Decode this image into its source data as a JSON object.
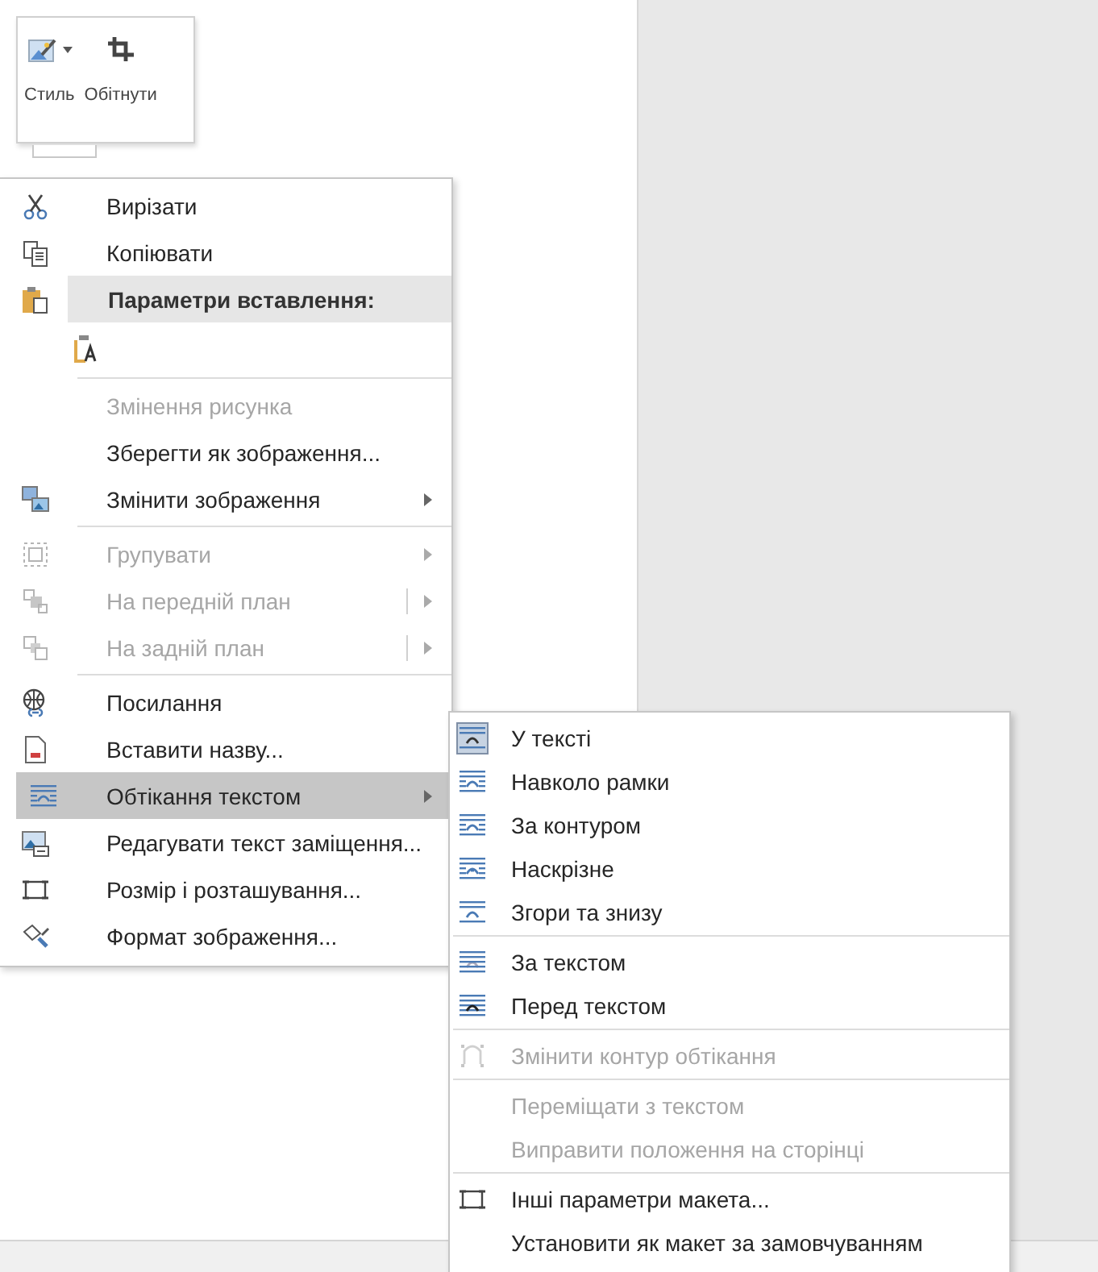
{
  "mini_toolbar": {
    "buttons": [
      {
        "label": "Стиль",
        "kind": "style",
        "dropdown": true
      },
      {
        "label": "Обітнути",
        "kind": "crop",
        "dropdown": false
      }
    ]
  },
  "context_menu": {
    "items": [
      {
        "kind": "cut",
        "label": "Вирізати",
        "disabled": false,
        "highlighted": false,
        "separator_before": false,
        "submenu": false,
        "split": false
      },
      {
        "kind": "copy",
        "label": "Копіювати",
        "disabled": false,
        "highlighted": false,
        "separator_before": false,
        "submenu": false,
        "split": false
      },
      {
        "kind": "paste_header",
        "label": "Параметри вставлення:"
      },
      {
        "kind": "paste_options"
      },
      {
        "kind": "plain",
        "label": "Змінення рисунка",
        "disabled": true,
        "highlighted": false,
        "separator_before": true,
        "submenu": false,
        "split": false
      },
      {
        "kind": "plain",
        "label": "Зберегти як зображення...",
        "disabled": false,
        "highlighted": false,
        "separator_before": false,
        "submenu": false,
        "split": false
      },
      {
        "kind": "change_picture",
        "label": "Змінити зображення",
        "disabled": false,
        "highlighted": false,
        "separator_before": false,
        "submenu": true,
        "split": false
      },
      {
        "kind": "group",
        "label": "Групувати",
        "disabled": true,
        "highlighted": false,
        "separator_before": true,
        "submenu": true,
        "split": false
      },
      {
        "kind": "front",
        "label": "На передній план",
        "disabled": true,
        "highlighted": false,
        "separator_before": false,
        "submenu": true,
        "split": true
      },
      {
        "kind": "back",
        "label": "На задній план",
        "disabled": true,
        "highlighted": false,
        "separator_before": false,
        "submenu": true,
        "split": true
      },
      {
        "kind": "link",
        "label": "Посилання",
        "disabled": false,
        "highlighted": false,
        "separator_before": true,
        "submenu": false,
        "split": false
      },
      {
        "kind": "caption",
        "label": "Вставити назву...",
        "disabled": false,
        "highlighted": false,
        "separator_before": false,
        "submenu": false,
        "split": false
      },
      {
        "kind": "wrap",
        "label": "Обтікання текстом",
        "disabled": false,
        "highlighted": true,
        "separator_before": false,
        "submenu": true,
        "split": false
      },
      {
        "kind": "alt_text",
        "label": "Редагувати текст заміщення...",
        "disabled": false,
        "highlighted": false,
        "separator_before": false,
        "submenu": false,
        "split": false
      },
      {
        "kind": "size",
        "label": "Розмір і розташування...",
        "disabled": false,
        "highlighted": false,
        "separator_before": false,
        "submenu": false,
        "split": false
      },
      {
        "kind": "format",
        "label": "Формат зображення...",
        "disabled": false,
        "highlighted": false,
        "separator_before": false,
        "submenu": false,
        "split": false
      }
    ]
  },
  "wrap_submenu": {
    "items": [
      {
        "kind": "inline",
        "label": "У тексті",
        "selected": true,
        "disabled": false,
        "separator_before": false
      },
      {
        "kind": "square",
        "label": "Навколо рамки",
        "selected": false,
        "disabled": false,
        "separator_before": false
      },
      {
        "kind": "tight",
        "label": "За контуром",
        "selected": false,
        "disabled": false,
        "separator_before": false
      },
      {
        "kind": "through",
        "label": "Наскрізне",
        "selected": false,
        "disabled": false,
        "separator_before": false
      },
      {
        "kind": "topbottom",
        "label": "Згори та знизу",
        "selected": false,
        "disabled": false,
        "separator_before": false
      },
      {
        "kind": "behind",
        "label": "За текстом",
        "selected": false,
        "disabled": false,
        "separator_before": true
      },
      {
        "kind": "front_text",
        "label": "Перед текстом",
        "selected": false,
        "disabled": false,
        "separator_before": false
      },
      {
        "kind": "edit_points",
        "label": "Змінити контур обтікання",
        "selected": false,
        "disabled": true,
        "separator_before": true
      },
      {
        "kind": "plain",
        "label": "Переміщати з текстом",
        "selected": false,
        "disabled": true,
        "separator_before": true
      },
      {
        "kind": "plain",
        "label": "Виправити положення на сторінці",
        "selected": false,
        "disabled": true,
        "separator_before": false
      },
      {
        "kind": "size",
        "label": "Інші параметри макета...",
        "selected": false,
        "disabled": false,
        "separator_before": true
      },
      {
        "kind": "plain",
        "label": "Установити як макет за замовчуванням",
        "selected": false,
        "disabled": false,
        "separator_before": false
      }
    ]
  }
}
